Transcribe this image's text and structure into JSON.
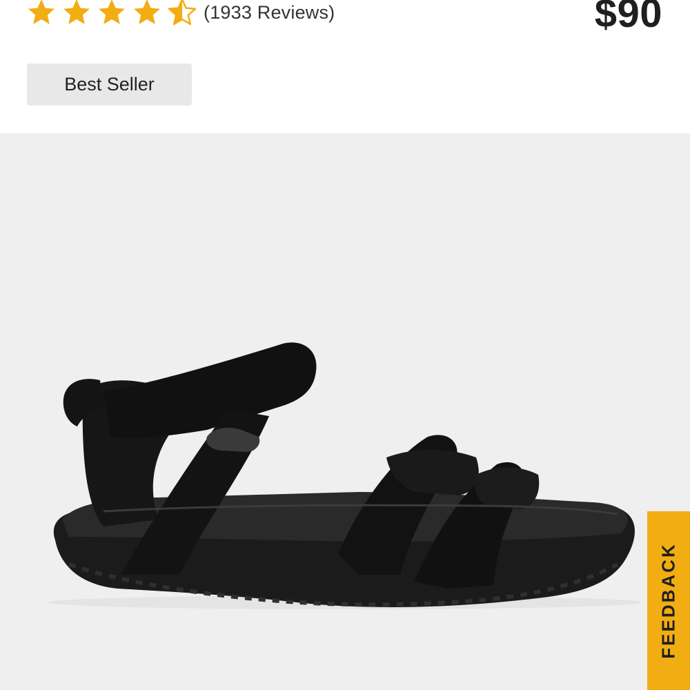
{
  "product": {
    "rating": 4.5,
    "rating_max": 5,
    "review_count_text": "(1933 Reviews)",
    "price": "$90",
    "badge": "Best Seller"
  },
  "media": {
    "main_image": "black-strappy-sandal-side-view",
    "background_color": "#efefef"
  },
  "feedback": {
    "label": "FEEDBACK"
  },
  "colors": {
    "star": "#f2ad12",
    "badge_bg": "#e8e8e8",
    "feedback_bg": "#f2ad12",
    "text": "#222222"
  },
  "icons": {
    "star": "star-icon",
    "half_star": "half-star-icon"
  }
}
